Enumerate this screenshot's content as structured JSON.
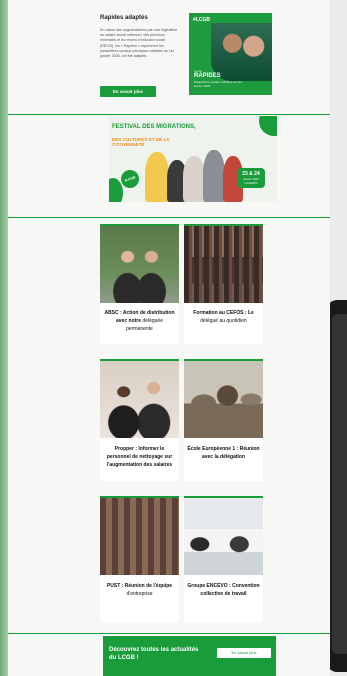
{
  "top_section": {
    "title": "Rapides adaptés",
    "body": "En raison des augmentations par voie législative du salaire social minimum, des pensions minimales et du revenu d'inclusion social (REVIS), les « Rapides » reprennent les paramètres sociaux principaux valables au 1er janvier 2026, ont été adaptés.",
    "button_label": "En savoir plus",
    "card": {
      "brand": "#LCGB",
      "small": "social",
      "title": "RAPIDES",
      "subtitle": "Paramètres sociaux valables au 1er janvier 2026"
    }
  },
  "festival": {
    "title": "Festival des migrations,",
    "subtitle": "des cultures et de la citoyenneté",
    "badge": "#LCGB",
    "date_main": "23 & 24",
    "date_sub": "février 2026 LUXEXPO"
  },
  "news": [
    {
      "caption_bold": "ABSC : Action de distribution avec notre",
      "caption_light": " déléguée permanente"
    },
    {
      "caption_bold": "Formation au CEFOS : Le",
      "caption_light": " délégué au quotidien"
    },
    {
      "caption_bold": "Propper : Informer le personnel de nettoyage sur l'augmentation des salaires",
      "caption_light": ""
    },
    {
      "caption_bold": "École Européenne 1 : Réunion avec la délégation",
      "caption_light": ""
    },
    {
      "caption_bold": "PUST : Réunion de l'équipe",
      "caption_light": " d'entreprise"
    },
    {
      "caption_bold": "Groupe ENCEVO : Convention collective de travail",
      "caption_light": ""
    }
  ],
  "cta": {
    "text": "Découvrez toutes les actualités du LCGB !",
    "button_label": "En savoir plus"
  },
  "colors": {
    "accent": "#1a9c3a",
    "festival_orange": "#f08b1a"
  }
}
